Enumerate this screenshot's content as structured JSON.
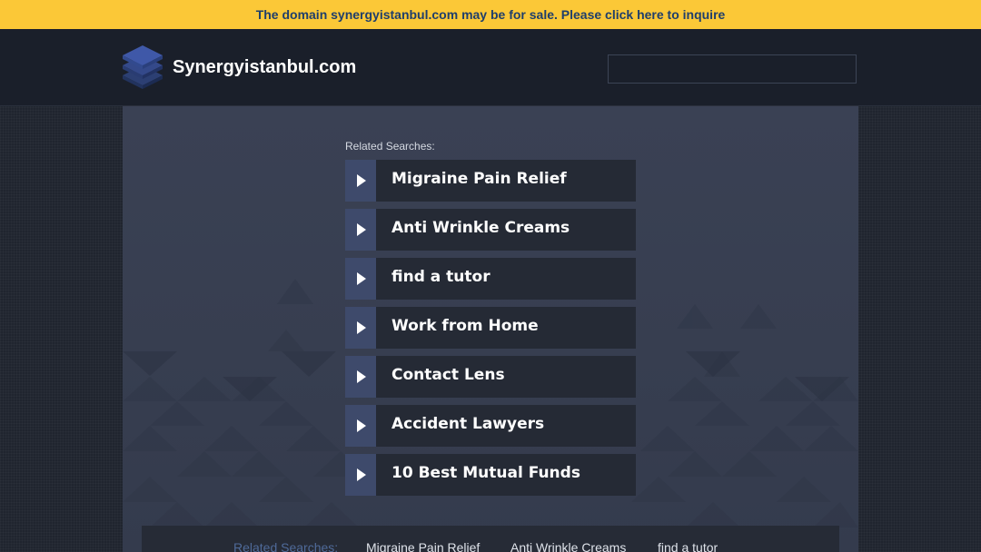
{
  "banner": {
    "text": "The domain synergyistanbul.com may be for sale. Please click here to inquire"
  },
  "header": {
    "site_title": "Synergyistanbul.com",
    "search_value": ""
  },
  "main": {
    "related_label": "Related Searches:",
    "links": [
      {
        "label": "Migraine Pain Relief"
      },
      {
        "label": "Anti Wrinkle Creams"
      },
      {
        "label": "find a tutor"
      },
      {
        "label": "Work from Home"
      },
      {
        "label": "Contact Lens"
      },
      {
        "label": "Accident Lawyers"
      },
      {
        "label": "10 Best Mutual Funds"
      }
    ]
  },
  "footer": {
    "related_label": "Related Searches:",
    "links": [
      {
        "label": "Migraine Pain Relief"
      },
      {
        "label": "Anti Wrinkle Creams"
      },
      {
        "label": "find a tutor"
      }
    ]
  },
  "colors": {
    "banner_bg": "#fbc837",
    "banner_text": "#1f3e6b",
    "arrow_bg": "#3e4a6b",
    "link_bg": "#252a35"
  },
  "icons": {
    "logo": "stacked-layers-icon",
    "arrow": "play-arrow-icon"
  }
}
